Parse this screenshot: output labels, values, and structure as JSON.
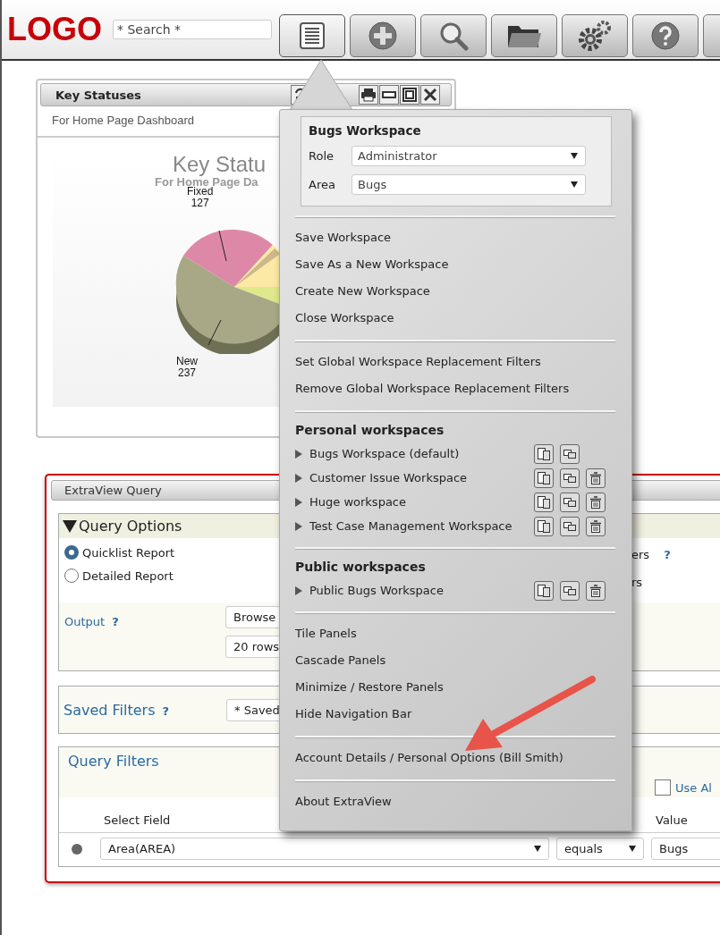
{
  "header": {
    "logo": "LOGO",
    "search": {
      "placeholder": "* Search *"
    },
    "toolbar": [
      {
        "kind": "list",
        "selected": true
      },
      {
        "kind": "add",
        "selected": false
      },
      {
        "kind": "search",
        "selected": false
      },
      {
        "kind": "folder",
        "selected": false
      },
      {
        "kind": "gears",
        "selected": false
      },
      {
        "kind": "help",
        "selected": false
      },
      {
        "kind": "blank",
        "selected": false
      }
    ]
  },
  "key_statuses": {
    "title": "Key Statuses",
    "subtitle": "For Home Page Dashboard",
    "chart_title": "Key Statu",
    "chart_subtitle": "For Home Page Da",
    "slices": [
      {
        "label": "Fixed",
        "count": "127"
      },
      {
        "label": "New",
        "count": "237"
      }
    ]
  },
  "query": {
    "title": "ExtraView Query",
    "options": {
      "title": "Query Options",
      "expanded": true,
      "report_types": [
        {
          "label": "Quicklist Report",
          "selected": true
        },
        {
          "label": "Detailed Report",
          "selected": false
        }
      ],
      "side_labels": [
        {
          "text": "ers",
          "help": "?"
        },
        {
          "text": "rs"
        }
      ],
      "output": {
        "label": "Output",
        "help": "?",
        "format": "Browse",
        "rows": "20 rows"
      }
    },
    "saved_filters": {
      "label": "Saved Filters",
      "help": "?",
      "value": "* Saved"
    },
    "query_filters": {
      "title": "Query Filters",
      "use_all": {
        "label": "Use Al",
        "checked": false
      },
      "columns": [
        "Select Field",
        "Value"
      ],
      "rows": [
        {
          "field": "Area(AREA)",
          "operator": "equals",
          "value": "Bugs"
        }
      ]
    }
  },
  "menu": {
    "workspace": {
      "title": "Bugs Workspace",
      "role_label": "Role",
      "role": "Administrator",
      "area_label": "Area",
      "area": "Bugs"
    },
    "sections": [
      {
        "kind": "actions",
        "items": [
          "Save Workspace",
          "Save As a New Workspace",
          "Create New Workspace",
          "Close Workspace"
        ]
      },
      {
        "kind": "actions",
        "items": [
          "Set Global Workspace Replacement Filters",
          "Remove Global Workspace Replacement Filters"
        ]
      },
      {
        "kind": "workspaces",
        "heading": "Personal workspaces",
        "workspaces": [
          {
            "name": "Bugs Workspace (default)",
            "deletable": false
          },
          {
            "name": "Customer Issue Workspace",
            "deletable": true
          },
          {
            "name": "Huge workspace",
            "deletable": true
          },
          {
            "name": "Test Case Management Workspace",
            "deletable": true
          }
        ]
      },
      {
        "kind": "workspaces",
        "heading": "Public workspaces",
        "workspaces": [
          {
            "name": "Public Bugs Workspace",
            "deletable": true
          }
        ]
      },
      {
        "kind": "actions",
        "items": [
          "Tile Panels",
          "Cascade Panels",
          "Minimize / Restore Panels",
          "Hide Navigation Bar"
        ]
      },
      {
        "kind": "actions",
        "items": [
          "Account Details / Personal Options (Bill Smith)"
        ]
      },
      {
        "kind": "actions",
        "items": [
          "About ExtraView"
        ]
      }
    ]
  }
}
